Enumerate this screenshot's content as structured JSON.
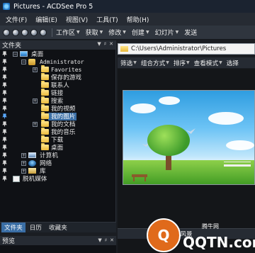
{
  "window": {
    "title": "Pictures - ACDSee Pro 5"
  },
  "menu": [
    "文件(F)",
    "编辑(E)",
    "视图(V)",
    "工具(T)",
    "帮助(H)"
  ],
  "toolbar": [
    "工作区",
    "获取",
    "修改",
    "创建",
    "幻灯片",
    "发送"
  ],
  "left_panel": {
    "title": "文件夹",
    "tree": [
      {
        "label": "桌面",
        "icon": "desktop-icon"
      },
      {
        "label": "Administrator",
        "icon": "user-folder-icon"
      },
      {
        "label": "Favorites",
        "icon": "folder-icon"
      },
      {
        "label": "保存的游戏",
        "icon": "folder-icon"
      },
      {
        "label": "联系人",
        "icon": "folder-icon"
      },
      {
        "label": "链接",
        "icon": "folder-icon"
      },
      {
        "label": "搜索",
        "icon": "folder-icon"
      },
      {
        "label": "我的视频",
        "icon": "folder-icon"
      },
      {
        "label": "我的图片",
        "icon": "folder-icon",
        "selected": true
      },
      {
        "label": "我的文档",
        "icon": "folder-icon"
      },
      {
        "label": "我的音乐",
        "icon": "folder-icon"
      },
      {
        "label": "下载",
        "icon": "folder-icon"
      },
      {
        "label": "桌面",
        "icon": "folder-icon"
      },
      {
        "label": "计算机",
        "icon": "computer-icon"
      },
      {
        "label": "网络",
        "icon": "network-icon"
      },
      {
        "label": "库",
        "icon": "library-icon"
      },
      {
        "label": "脱机媒体",
        "icon": "media-icon"
      }
    ],
    "tabs": [
      "文件夹",
      "日历",
      "收藏夹"
    ]
  },
  "preview_panel": {
    "title": "预览"
  },
  "right_panel": {
    "path": "C:\\Users\\Administrator\\Pictures",
    "subtoolbar": [
      "筛选",
      "组合方式",
      "排序",
      "查看模式",
      "选择"
    ],
    "thumbnail_caption": "风景"
  },
  "watermark": {
    "logo_text": "Q",
    "text": "QQTN.com",
    "small_text": "腾牛网"
  },
  "colors": {
    "selection": "#3a6ea5",
    "title_bar": "#1b2330",
    "panel_bg": "#0f1115"
  }
}
